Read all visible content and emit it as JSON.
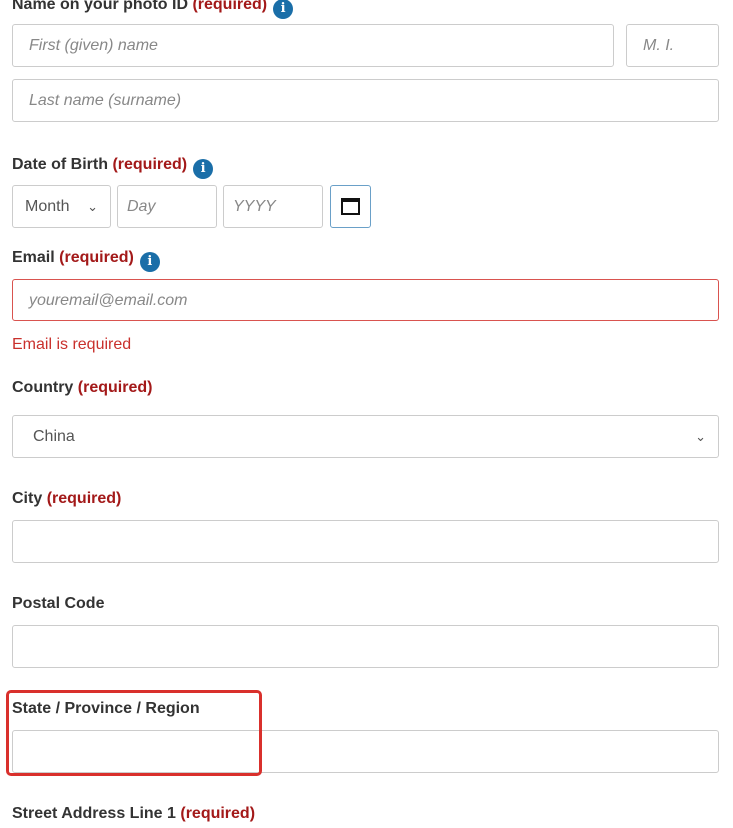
{
  "name": {
    "label": "Name on your photo ID",
    "required": "(required)",
    "info_icon": "info-icon",
    "first_placeholder": "First (given) name",
    "mi_placeholder": "M. I.",
    "last_placeholder": "Last name (surname)"
  },
  "dob": {
    "label": "Date of Birth",
    "required": "(required)",
    "month": "Month",
    "day_placeholder": "Day",
    "year_placeholder": "YYYY",
    "calendar_icon": "calendar-icon"
  },
  "email": {
    "label": "Email",
    "required": "(required)",
    "placeholder": "youremail@email.com",
    "error": "Email is required"
  },
  "country": {
    "label": "Country",
    "required": "(required)",
    "value": "China"
  },
  "city": {
    "label": "City",
    "required": "(required)",
    "value": ""
  },
  "postal": {
    "label": "Postal Code",
    "value": ""
  },
  "state": {
    "label": "State / Province / Region",
    "value": ""
  },
  "street1": {
    "label": "Street Address Line 1",
    "required": "(required)"
  },
  "colors": {
    "required": "#a31919",
    "error": "#c9302c",
    "info": "#1a6ea8",
    "highlight": "#d9302c"
  }
}
